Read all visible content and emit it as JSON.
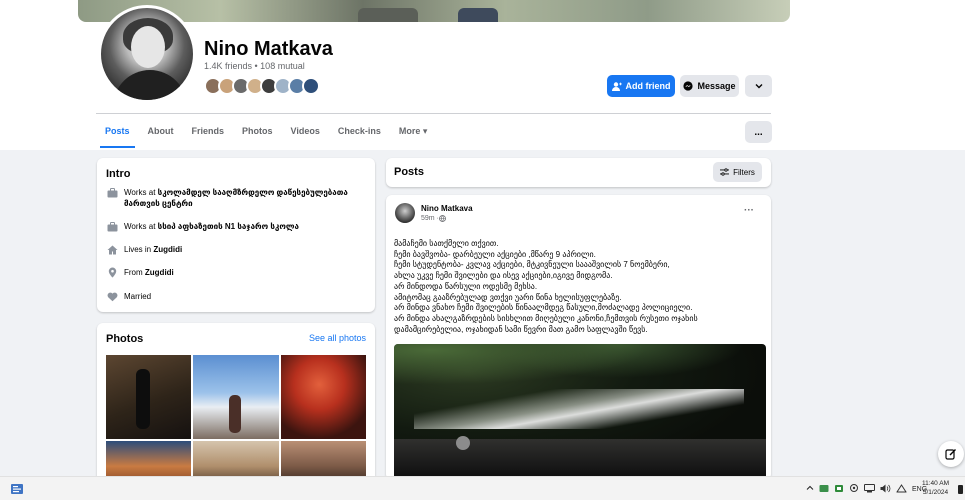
{
  "profile": {
    "name": "Nino Matkava",
    "friends_line": "1.4K friends • 108 mutual",
    "friend_avatar_colors": [
      "#8a6f5b",
      "#c9a27a",
      "#6b6b6b",
      "#d0b08a",
      "#3d3d3d",
      "#9fb3c8",
      "#5a7ea6",
      "#2e4f7a"
    ],
    "add_friend_label": "Add friend",
    "message_label": "Message"
  },
  "tabs": [
    {
      "label": "Posts"
    },
    {
      "label": "About"
    },
    {
      "label": "Friends"
    },
    {
      "label": "Photos"
    },
    {
      "label": "Videos"
    },
    {
      "label": "Check-ins"
    },
    {
      "label": "More ▾"
    }
  ],
  "more_menu_label": "...",
  "intro": {
    "title": "Intro",
    "work1_prefix": "Works at ",
    "work1_place": "სკოლამდელ სააღმზრდელო დაწესებულებათა მართვის ცენტრი",
    "work2_prefix": "Works at ",
    "work2_place": "სსიპ აფხაზეთის N1 საჯარო სკოლა",
    "lives_prefix": "Lives in ",
    "lives_place": "Zugdidi",
    "from_prefix": "From ",
    "from_place": "Zugdidi",
    "relationship": "Married"
  },
  "photos": {
    "title": "Photos",
    "see_all_label": "See all photos"
  },
  "posts_section": {
    "title": "Posts",
    "filters_label": "Filters"
  },
  "post": {
    "author": "Nino Matkava",
    "time": "59m · ",
    "options_label": "···",
    "text": "მამაჩემი სათქმელი თქვით.\nჩემი ბავშვობა- დარბეული აქციები ,მწარე 9 აპრილი.\nჩემი სტუდენტობა- კვლავ აქციები, მტკივნეული საააშვილის 7 ნოემბერი,\nახლა უკვე ჩემი შვილები და ისევ აქციები,იგივე მიდგომა.\nარ მინდოდა წარსული ოდესმე მეხსა.\nამიტომაც გააზრებულად ვთქვი უარი წინა ხელისუფლებაზე.\nარ მინდა ვნახო ჩემი შვილების წინაალმდეგ წასული,მოძალადე პოლიციელი.\nარ მინდა ახალგაზრდების  სისხლით მიღებული კანონი,ჩემთვის რუსეთი ოჯახის\nდამამცირებელია, ოჯახიდან სამი წევრი მათ გამო საფლავში წევს."
  },
  "taskbar": {
    "lang": "ENG",
    "time": "11:40 AM",
    "date": "5/1/2024"
  },
  "colors": {
    "brand": "#1877f2",
    "background": "#f0f2f5",
    "secondary_text": "#65676b"
  }
}
